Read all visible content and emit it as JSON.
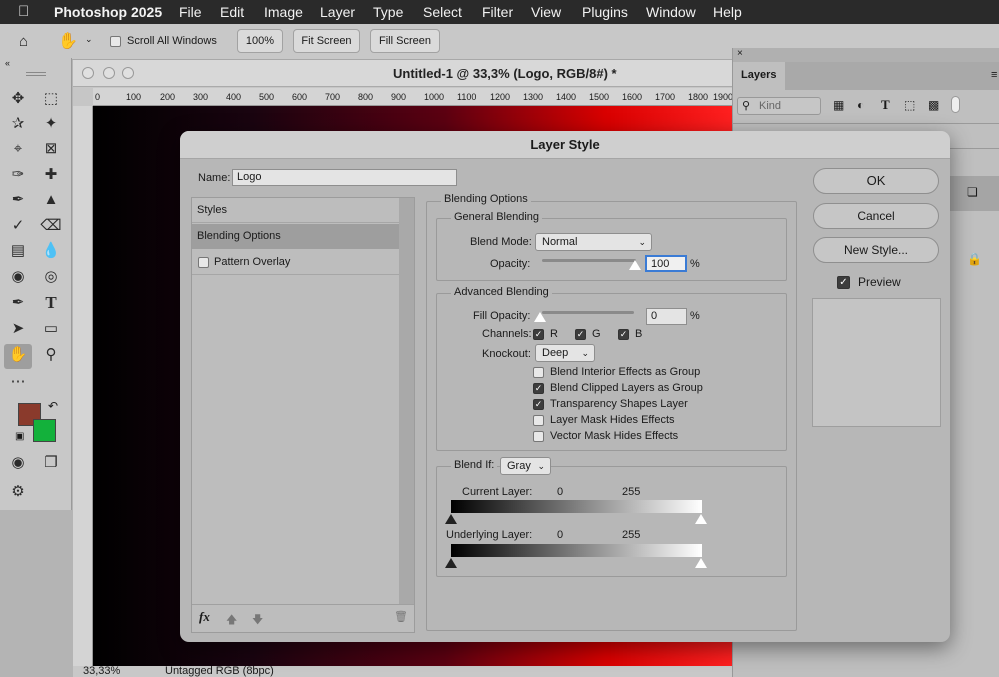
{
  "menubar": {
    "app_name": "Photoshop 2025",
    "items": [
      "File",
      "Edit",
      "Image",
      "Layer",
      "Type",
      "Select",
      "Filter",
      "View",
      "Plugins",
      "Window",
      "Help"
    ]
  },
  "options_bar": {
    "scroll_all_label": "Scroll All Windows",
    "zoom_100": "100%",
    "fit_screen": "Fit Screen",
    "fill_screen": "Fill Screen"
  },
  "document": {
    "title": "Untitled-1 @ 33,3% (Logo, RGB/8#) *",
    "ruler_ticks": [
      "0",
      "100",
      "200",
      "300",
      "400",
      "500",
      "600",
      "700",
      "800",
      "900",
      "1000",
      "1100",
      "1200",
      "1300",
      "1400",
      "1500",
      "1600",
      "1700",
      "1800",
      "1900"
    ],
    "status_zoom": "33,33%",
    "status_info": "Untagged RGB (8bpc)"
  },
  "colors": {
    "foreground": "#8a3a2c",
    "background": "#13b13b"
  },
  "layers_panel": {
    "tab_label": "Layers",
    "kind_label": "Kind"
  },
  "dialog": {
    "title": "Layer Style",
    "name_label": "Name:",
    "name_value": "Logo",
    "styles_header": "Styles",
    "styles_items": [
      "Blending Options",
      "Pattern Overlay"
    ],
    "section_title": "Blending Options",
    "general_title": "General Blending",
    "blend_mode_label": "Blend Mode:",
    "blend_mode_value": "Normal",
    "opacity_label": "Opacity:",
    "opacity_value": "100",
    "pct": "%",
    "advanced_title": "Advanced Blending",
    "fill_opacity_label": "Fill Opacity:",
    "fill_opacity_value": "0",
    "channels_label": "Channels:",
    "channel_r": "R",
    "channel_g": "G",
    "channel_b": "B",
    "knockout_label": "Knockout:",
    "knockout_value": "Deep",
    "options": [
      {
        "label": "Blend Interior Effects as Group",
        "checked": false
      },
      {
        "label": "Blend Clipped Layers as Group",
        "checked": true
      },
      {
        "label": "Transparency Shapes Layer",
        "checked": true
      },
      {
        "label": "Layer Mask Hides Effects",
        "checked": false
      },
      {
        "label": "Vector Mask Hides Effects",
        "checked": false
      }
    ],
    "blend_if_label": "Blend If:",
    "blend_if_value": "Gray",
    "current_layer_label": "Current Layer:",
    "current_min": "0",
    "current_max": "255",
    "underlying_layer_label": "Underlying Layer:",
    "underlying_min": "0",
    "underlying_max": "255",
    "fx_label": "fx",
    "ok": "OK",
    "cancel": "Cancel",
    "new_style": "New Style...",
    "preview_label": "Preview"
  }
}
